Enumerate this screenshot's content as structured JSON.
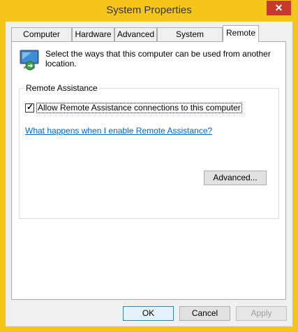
{
  "window": {
    "title": "System Properties",
    "close_label": "✕"
  },
  "tabs": [
    {
      "label": "Computer Name",
      "active": false
    },
    {
      "label": "Hardware",
      "active": false
    },
    {
      "label": "Advanced",
      "active": false
    },
    {
      "label": "System Protection",
      "active": false
    },
    {
      "label": "Remote",
      "active": true
    }
  ],
  "remote": {
    "description": "Select the ways that this computer can be used from another location.",
    "group_title": "Remote Assistance",
    "allow_checkbox": {
      "label": "Allow Remote Assistance connections to this computer",
      "checked": true,
      "check_glyph": "✓"
    },
    "help_link": "What happens when I enable Remote Assistance?",
    "advanced_button": "Advanced..."
  },
  "footer": {
    "ok": "OK",
    "cancel": "Cancel",
    "apply": "Apply"
  },
  "colors": {
    "window_border": "#f5c518",
    "close_button": "#c7392b",
    "link": "#0066cc"
  },
  "icons": {
    "close": "close-icon",
    "remote": "remote-computer-icon"
  }
}
